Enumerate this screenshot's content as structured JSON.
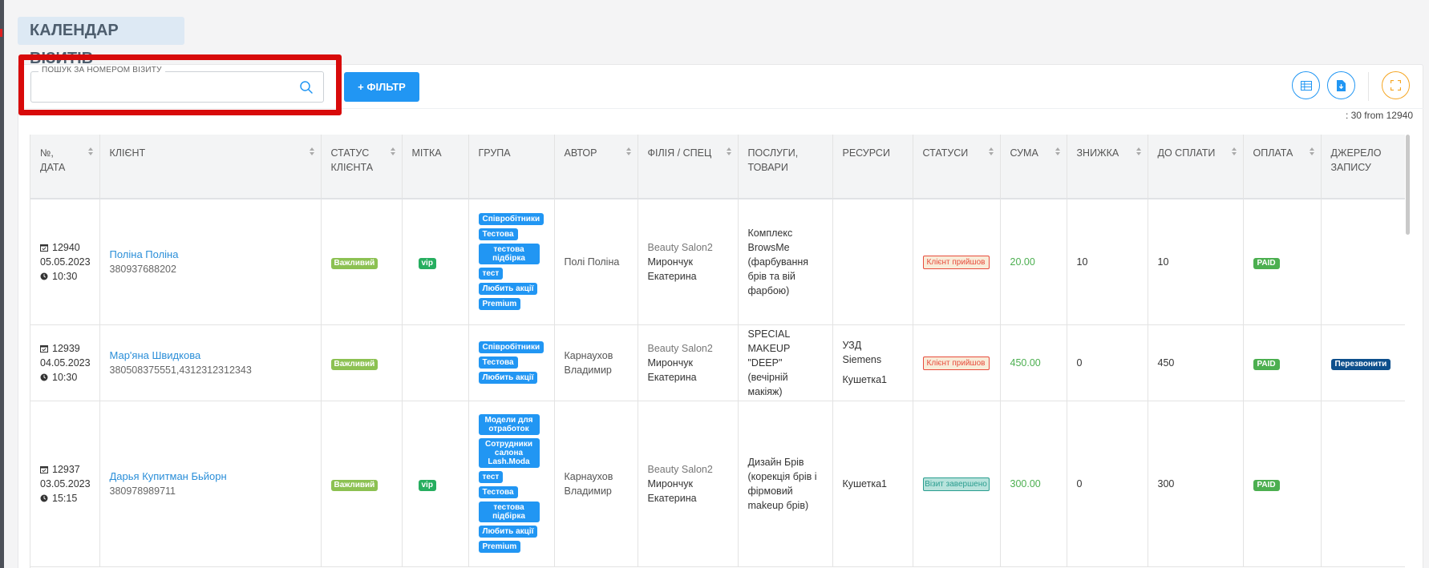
{
  "page": {
    "title": "КАЛЕНДАР ВІЗИТІВ"
  },
  "search": {
    "label": "ПОШУК ЗА НОМЕРОМ ВІЗИТУ",
    "value": "",
    "placeholder": ""
  },
  "toolbar": {
    "filter_label": "+ ФІЛЬТР"
  },
  "summary": {
    "count_text": ": 30 from 12940"
  },
  "colors": {
    "accent": "#2196f3",
    "highlight": "#d80a0a",
    "sum_green": "#4caf50",
    "badge_green": "#8cc152"
  },
  "icons": [
    "search-icon",
    "columns-icon",
    "export-icon",
    "fullscreen-icon",
    "calendar-icon",
    "clock-icon"
  ],
  "table": {
    "columns": [
      {
        "line1": "№,",
        "line2": "ДАТА"
      },
      {
        "line1": "КЛІЄНТ",
        "line2": ""
      },
      {
        "line1": "СТАТУС",
        "line2": "КЛІЄНТА"
      },
      {
        "line1": "МІТКА",
        "line2": ""
      },
      {
        "line1": "ГРУПА",
        "line2": ""
      },
      {
        "line1": "АВТОР",
        "line2": ""
      },
      {
        "line1": "ФІЛІЯ / СПЕЦ",
        "line2": ""
      },
      {
        "line1": "ПОСЛУГИ,",
        "line2": "ТОВАРИ"
      },
      {
        "line1": "РЕСУРСИ",
        "line2": ""
      },
      {
        "line1": "СТАТУСИ",
        "line2": ""
      },
      {
        "line1": "СУМА",
        "line2": ""
      },
      {
        "line1": "ЗНИЖКА",
        "line2": ""
      },
      {
        "line1": "ДО СПЛАТИ",
        "line2": ""
      },
      {
        "line1": "ОПЛАТА",
        "line2": ""
      },
      {
        "line1": "ДЖЕРЕЛО",
        "line2": "ЗАПИСУ"
      }
    ],
    "rows": [
      {
        "number": "12940",
        "date": "05.05.2023",
        "time": "10:30",
        "client_name": "Поліна Поліна",
        "client_phone": "380937688202",
        "client_status": "Важливий",
        "tag": "vip",
        "groups": [
          "Співробітники",
          "Тестова",
          "тестова підбірка",
          "тест",
          "Любить акції",
          "Premium"
        ],
        "author": "Полі Поліна",
        "branch": "Beauty Salon2",
        "spec1": "Мирончук",
        "spec2": "Екатерина",
        "services": "Комплекс BrowsMe (фарбування брів та вій фарбою)",
        "resource1": "",
        "resource2": "",
        "status": "Клієнт прийшов",
        "sum": "20.00",
        "discount": "10",
        "to_pay": "10",
        "payment": "PAID",
        "source": ""
      },
      {
        "number": "12939",
        "date": "04.05.2023",
        "time": "10:30",
        "client_name": "Мар'яна Швидкова",
        "client_phone": "380508375551,4312312312343",
        "client_status": "Важливий",
        "tag": "",
        "groups": [
          "Співробітники",
          "Тестова",
          "Любить акції"
        ],
        "author": "Карнаухов Владимир",
        "branch": "Beauty Salon2",
        "spec1": "Мирончук",
        "spec2": "Екатерина",
        "services": "SPECIAL MAKEUP \"DEEP\" (вечірній макіяж)",
        "resource1": "УЗД Siemens",
        "resource2": "Кушетка1",
        "status": "Клієнт прийшов",
        "sum": "450.00",
        "discount": "0",
        "to_pay": "450",
        "payment": "PAID",
        "source": "Перезвонити"
      },
      {
        "number": "12937",
        "date": "03.05.2023",
        "time": "15:15",
        "client_name": "Дарья Купитман Бьйорн",
        "client_phone": "380978989711",
        "client_status": "Важливий",
        "tag": "vip",
        "groups": [
          "Модели для отработок",
          "Сотрудники салона Lash.Moda",
          "тест",
          "Тестова",
          "тестова підбірка",
          "Любить акції",
          "Premium"
        ],
        "author": "Карнаухов Владимир",
        "branch": "Beauty Salon2",
        "spec1": "Мирончук",
        "spec2": "Екатерина",
        "services": "Дизайн Брів (корекція брів і фірмовий makeup брів)",
        "resource1": "Кушетка1",
        "resource2": "",
        "status": "Візит завершено",
        "sum": "300.00",
        "discount": "0",
        "to_pay": "300",
        "payment": "PAID",
        "source": ""
      }
    ]
  }
}
